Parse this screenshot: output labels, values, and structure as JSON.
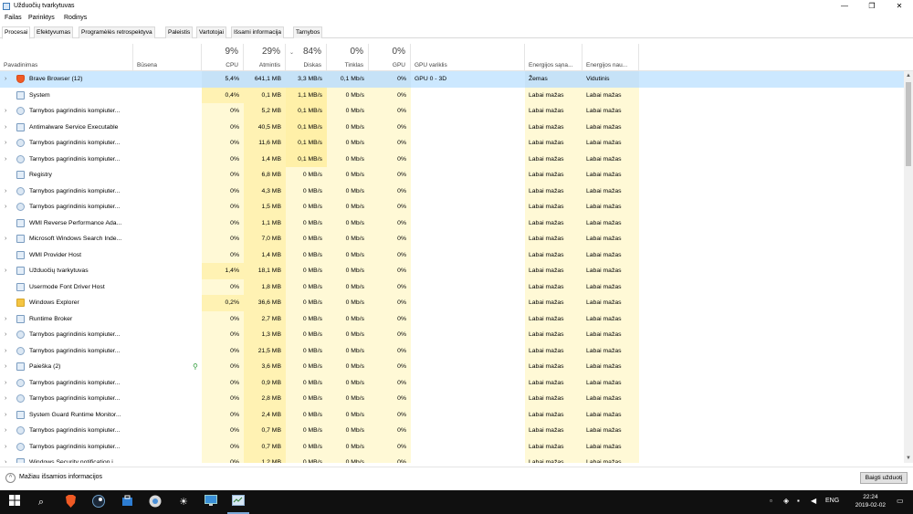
{
  "window": {
    "title": "Užduočių tvarkytuvas",
    "minimize": "—",
    "maximize": "❐",
    "close": "✕"
  },
  "menu": [
    "Failas",
    "Parinktys",
    "Rodinys"
  ],
  "tabs": [
    "Procesai",
    "Efektyvumas",
    "Programėlės retrospektyva",
    "Paleistis",
    "Vartotojai",
    "Išsami informacija",
    "Tarnybos"
  ],
  "header": {
    "name": "Pavadinimas",
    "status": "Būsena",
    "cpu": {
      "pct": "9%",
      "label": "CPU"
    },
    "memory": {
      "pct": "29%",
      "label": "Atmintis"
    },
    "disk": {
      "pct": "84%",
      "label": "Diskas"
    },
    "network": {
      "pct": "0%",
      "label": "Tinklas"
    },
    "gpu": {
      "pct": "0%",
      "label": "GPU"
    },
    "gpu_engine": "GPU variklis",
    "power": "Energijos sąna...",
    "power_trend": "Energijos nau..."
  },
  "processes": [
    {
      "name": "Brave Browser (12)",
      "icon": "brave-icon",
      "expand": true,
      "cpu": "5,4%",
      "mem": "641,1 MB",
      "disk": "3,3 MB/s",
      "net": "0,1 Mb/s",
      "gpu": "0%",
      "engine": "GPU 0 - 3D",
      "power": "Žemas",
      "trend": "Vidutinis",
      "selected": true
    },
    {
      "name": "System",
      "icon": "window-icon",
      "expand": false,
      "cpu": "0,4%",
      "mem": "0,1 MB",
      "disk": "1,1 MB/s",
      "net": "0 Mb/s",
      "gpu": "0%",
      "engine": "",
      "power": "Labai mažas",
      "trend": "Labai mažas"
    },
    {
      "name": "Tarnybos pagrindinis kompiuter...",
      "icon": "gear-icon",
      "expand": true,
      "cpu": "0%",
      "mem": "5,2 MB",
      "disk": "0,1 MB/s",
      "net": "0 Mb/s",
      "gpu": "0%",
      "engine": "",
      "power": "Labai mažas",
      "trend": "Labai mažas"
    },
    {
      "name": "Antimalware Service Executable",
      "icon": "window-icon",
      "expand": true,
      "cpu": "0%",
      "mem": "40,5 MB",
      "disk": "0,1 MB/s",
      "net": "0 Mb/s",
      "gpu": "0%",
      "engine": "",
      "power": "Labai mažas",
      "trend": "Labai mažas"
    },
    {
      "name": "Tarnybos pagrindinis kompiuter...",
      "icon": "gear-icon",
      "expand": true,
      "cpu": "0%",
      "mem": "11,6 MB",
      "disk": "0,1 MB/s",
      "net": "0 Mb/s",
      "gpu": "0%",
      "engine": "",
      "power": "Labai mažas",
      "trend": "Labai mažas"
    },
    {
      "name": "Tarnybos pagrindinis kompiuter...",
      "icon": "gear-icon",
      "expand": true,
      "cpu": "0%",
      "mem": "1,4 MB",
      "disk": "0,1 MB/s",
      "net": "0 Mb/s",
      "gpu": "0%",
      "engine": "",
      "power": "Labai mažas",
      "trend": "Labai mažas"
    },
    {
      "name": "Registry",
      "icon": "window-icon",
      "expand": false,
      "cpu": "0%",
      "mem": "6,8 MB",
      "disk": "0 MB/s",
      "net": "0 Mb/s",
      "gpu": "0%",
      "engine": "",
      "power": "Labai mažas",
      "trend": "Labai mažas"
    },
    {
      "name": "Tarnybos pagrindinis kompiuter...",
      "icon": "gear-icon",
      "expand": true,
      "cpu": "0%",
      "mem": "4,3 MB",
      "disk": "0 MB/s",
      "net": "0 Mb/s",
      "gpu": "0%",
      "engine": "",
      "power": "Labai mažas",
      "trend": "Labai mažas"
    },
    {
      "name": "Tarnybos pagrindinis kompiuter...",
      "icon": "gear-icon",
      "expand": true,
      "cpu": "0%",
      "mem": "1,5 MB",
      "disk": "0 MB/s",
      "net": "0 Mb/s",
      "gpu": "0%",
      "engine": "",
      "power": "Labai mažas",
      "trend": "Labai mažas"
    },
    {
      "name": "WMI Reverse Performance Ada...",
      "icon": "window-icon",
      "expand": false,
      "cpu": "0%",
      "mem": "1,1 MB",
      "disk": "0 MB/s",
      "net": "0 Mb/s",
      "gpu": "0%",
      "engine": "",
      "power": "Labai mažas",
      "trend": "Labai mažas"
    },
    {
      "name": "Microsoft Windows Search Inde...",
      "icon": "window-icon",
      "expand": true,
      "cpu": "0%",
      "mem": "7,0 MB",
      "disk": "0 MB/s",
      "net": "0 Mb/s",
      "gpu": "0%",
      "engine": "",
      "power": "Labai mažas",
      "trend": "Labai mažas"
    },
    {
      "name": "WMI Provider Host",
      "icon": "window-icon",
      "expand": false,
      "cpu": "0%",
      "mem": "1,4 MB",
      "disk": "0 MB/s",
      "net": "0 Mb/s",
      "gpu": "0%",
      "engine": "",
      "power": "Labai mažas",
      "trend": "Labai mažas"
    },
    {
      "name": "Užduočių tvarkytuvas",
      "icon": "window-icon",
      "expand": true,
      "cpu": "1,4%",
      "mem": "18,1 MB",
      "disk": "0 MB/s",
      "net": "0 Mb/s",
      "gpu": "0%",
      "engine": "",
      "power": "Labai mažas",
      "trend": "Labai mažas"
    },
    {
      "name": "Usermode Font Driver Host",
      "icon": "window-icon",
      "expand": false,
      "cpu": "0%",
      "mem": "1,8 MB",
      "disk": "0 MB/s",
      "net": "0 Mb/s",
      "gpu": "0%",
      "engine": "",
      "power": "Labai mažas",
      "trend": "Labai mažas"
    },
    {
      "name": "Windows Explorer",
      "icon": "folder-icon",
      "expand": false,
      "cpu": "0,2%",
      "mem": "36,6 MB",
      "disk": "0 MB/s",
      "net": "0 Mb/s",
      "gpu": "0%",
      "engine": "",
      "power": "Labai mažas",
      "trend": "Labai mažas"
    },
    {
      "name": "Runtime Broker",
      "icon": "window-icon",
      "expand": true,
      "cpu": "0%",
      "mem": "2,7 MB",
      "disk": "0 MB/s",
      "net": "0 Mb/s",
      "gpu": "0%",
      "engine": "",
      "power": "Labai mažas",
      "trend": "Labai mažas"
    },
    {
      "name": "Tarnybos pagrindinis kompiuter...",
      "icon": "gear-icon",
      "expand": true,
      "cpu": "0%",
      "mem": "1,3 MB",
      "disk": "0 MB/s",
      "net": "0 Mb/s",
      "gpu": "0%",
      "engine": "",
      "power": "Labai mažas",
      "trend": "Labai mažas"
    },
    {
      "name": "Tarnybos pagrindinis kompiuter...",
      "icon": "gear-icon",
      "expand": true,
      "cpu": "0%",
      "mem": "21,5 MB",
      "disk": "0 MB/s",
      "net": "0 Mb/s",
      "gpu": "0%",
      "engine": "",
      "power": "Labai mažas",
      "trend": "Labai mažas"
    },
    {
      "name": "Paieška (2)",
      "icon": "window-icon",
      "expand": true,
      "cpu": "0%",
      "mem": "3,6 MB",
      "disk": "0 MB/s",
      "net": "0 Mb/s",
      "gpu": "0%",
      "engine": "",
      "power": "Labai mažas",
      "trend": "Labai mažas",
      "suspended": true
    },
    {
      "name": "Tarnybos pagrindinis kompiuter...",
      "icon": "gear-icon",
      "expand": true,
      "cpu": "0%",
      "mem": "0,9 MB",
      "disk": "0 MB/s",
      "net": "0 Mb/s",
      "gpu": "0%",
      "engine": "",
      "power": "Labai mažas",
      "trend": "Labai mažas"
    },
    {
      "name": "Tarnybos pagrindinis kompiuter...",
      "icon": "gear-icon",
      "expand": true,
      "cpu": "0%",
      "mem": "2,8 MB",
      "disk": "0 MB/s",
      "net": "0 Mb/s",
      "gpu": "0%",
      "engine": "",
      "power": "Labai mažas",
      "trend": "Labai mažas"
    },
    {
      "name": "System Guard Runtime Monitor...",
      "icon": "window-icon",
      "expand": true,
      "cpu": "0%",
      "mem": "2,4 MB",
      "disk": "0 MB/s",
      "net": "0 Mb/s",
      "gpu": "0%",
      "engine": "",
      "power": "Labai mažas",
      "trend": "Labai mažas"
    },
    {
      "name": "Tarnybos pagrindinis kompiuter...",
      "icon": "gear-icon",
      "expand": true,
      "cpu": "0%",
      "mem": "0,7 MB",
      "disk": "0 MB/s",
      "net": "0 Mb/s",
      "gpu": "0%",
      "engine": "",
      "power": "Labai mažas",
      "trend": "Labai mažas"
    },
    {
      "name": "Tarnybos pagrindinis kompiuter...",
      "icon": "gear-icon",
      "expand": true,
      "cpu": "0%",
      "mem": "0,7 MB",
      "disk": "0 MB/s",
      "net": "0 Mb/s",
      "gpu": "0%",
      "engine": "",
      "power": "Labai mažas",
      "trend": "Labai mažas"
    },
    {
      "name": "Windows Security notification i...",
      "icon": "window-icon",
      "expand": true,
      "cpu": "0%",
      "mem": "1,2 MB",
      "disk": "0 MB/s",
      "net": "0 Mb/s",
      "gpu": "0%",
      "engine": "",
      "power": "Labai mažas",
      "trend": "Labai mažas"
    }
  ],
  "footer": {
    "fewer_details": "Mažiau išsamios informacijos",
    "end_task": "Baigti užduotį"
  },
  "taskbar": {
    "lang": "ENG",
    "time": "22:24",
    "date": "2019-02-02"
  },
  "colors": {
    "selection": "#cce8ff",
    "heat_low": "#fff9d6",
    "heat_mid": "#fff2b3",
    "taskbar": "#101010"
  }
}
